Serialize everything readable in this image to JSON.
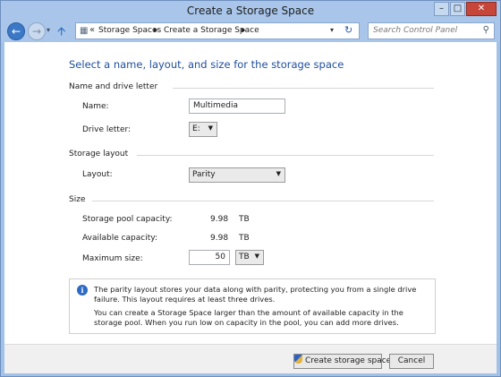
{
  "window": {
    "title": "Create a Storage Space",
    "controls": {
      "minimize": "–",
      "maximize": "□",
      "close": "✕"
    }
  },
  "nav": {
    "back_icon": "back-arrow-icon",
    "forward_icon": "forward-arrow-icon",
    "up_icon": "up-arrow-icon",
    "breadcrumbs": [
      "Storage Spaces",
      "Create a Storage Space"
    ],
    "search_placeholder": "Search Control Panel"
  },
  "page": {
    "heading": "Select a name, layout, and size for the storage space",
    "sections": {
      "name": {
        "title": "Name and drive letter",
        "name_label": "Name:",
        "name_value": "Multimedia",
        "drive_label": "Drive letter:",
        "drive_value": "E:"
      },
      "layout": {
        "title": "Storage layout",
        "layout_label": "Layout:",
        "layout_value": "Parity"
      },
      "size": {
        "title": "Size",
        "pool_label": "Storage pool capacity:",
        "pool_value": "9.98",
        "pool_unit": "TB",
        "avail_label": "Available capacity:",
        "avail_value": "9.98",
        "avail_unit": "TB",
        "max_label": "Maximum size:",
        "max_value": "50",
        "max_unit": "TB"
      }
    },
    "info": {
      "line1": "The parity layout stores your data along with parity, protecting you from a single drive failure. This layout requires at least three drives.",
      "line2": "You can create a Storage Space larger than the amount of available capacity in the storage pool. When you run low on capacity in the pool, you can add more drives."
    }
  },
  "footer": {
    "create_label": "Create storage space",
    "cancel_label": "Cancel"
  },
  "colors": {
    "heading": "#1f4e9c",
    "frame": "#a9c6ea",
    "close": "#c7463a"
  }
}
